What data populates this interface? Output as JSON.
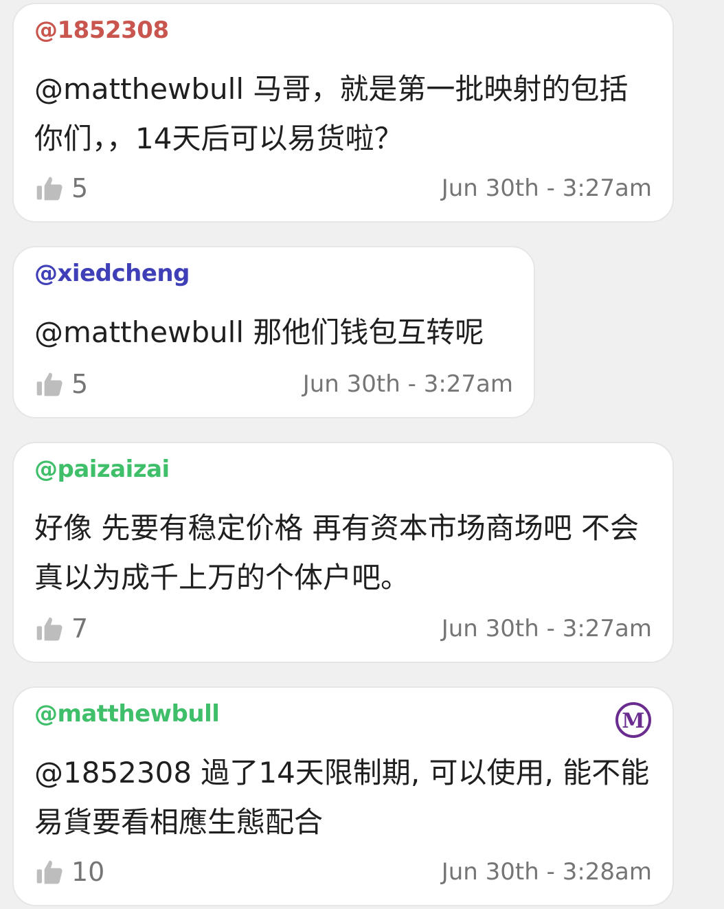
{
  "comments": [
    {
      "username": "@1852308",
      "user_color": "#c9554f",
      "text": "@matthewbull 马哥，就是第一批映射的包括你们，，14天后可以易货啦？",
      "likes": "5",
      "timestamp": "Jun 30th - 3:27am"
    },
    {
      "username": "@xiedcheng",
      "user_color": "#3f3fb8",
      "text": "@matthewbull 那他们钱包互转呢",
      "likes": "5",
      "timestamp": "Jun 30th - 3:27am"
    },
    {
      "username": "@paizaizai",
      "user_color": "#3fbf6a",
      "text": "好像 先要有稳定价格 再有资本市场商场吧 不会真以为成千上万的个体户吧。",
      "likes": "7",
      "timestamp": "Jun 30th - 3:27am"
    },
    {
      "username": "@matthewbull",
      "user_color": "#3fbf6a",
      "text": "@1852308 過了14天限制期, 可以使用, 能不能易貨要看相應生態配合",
      "likes": "10",
      "timestamp": "Jun 30th - 3:28am",
      "badge": "M",
      "badge_color": "#6a2d8f"
    }
  ],
  "icons": {
    "like": "thumbs-up-icon",
    "badge": "m-circle-badge-icon"
  }
}
